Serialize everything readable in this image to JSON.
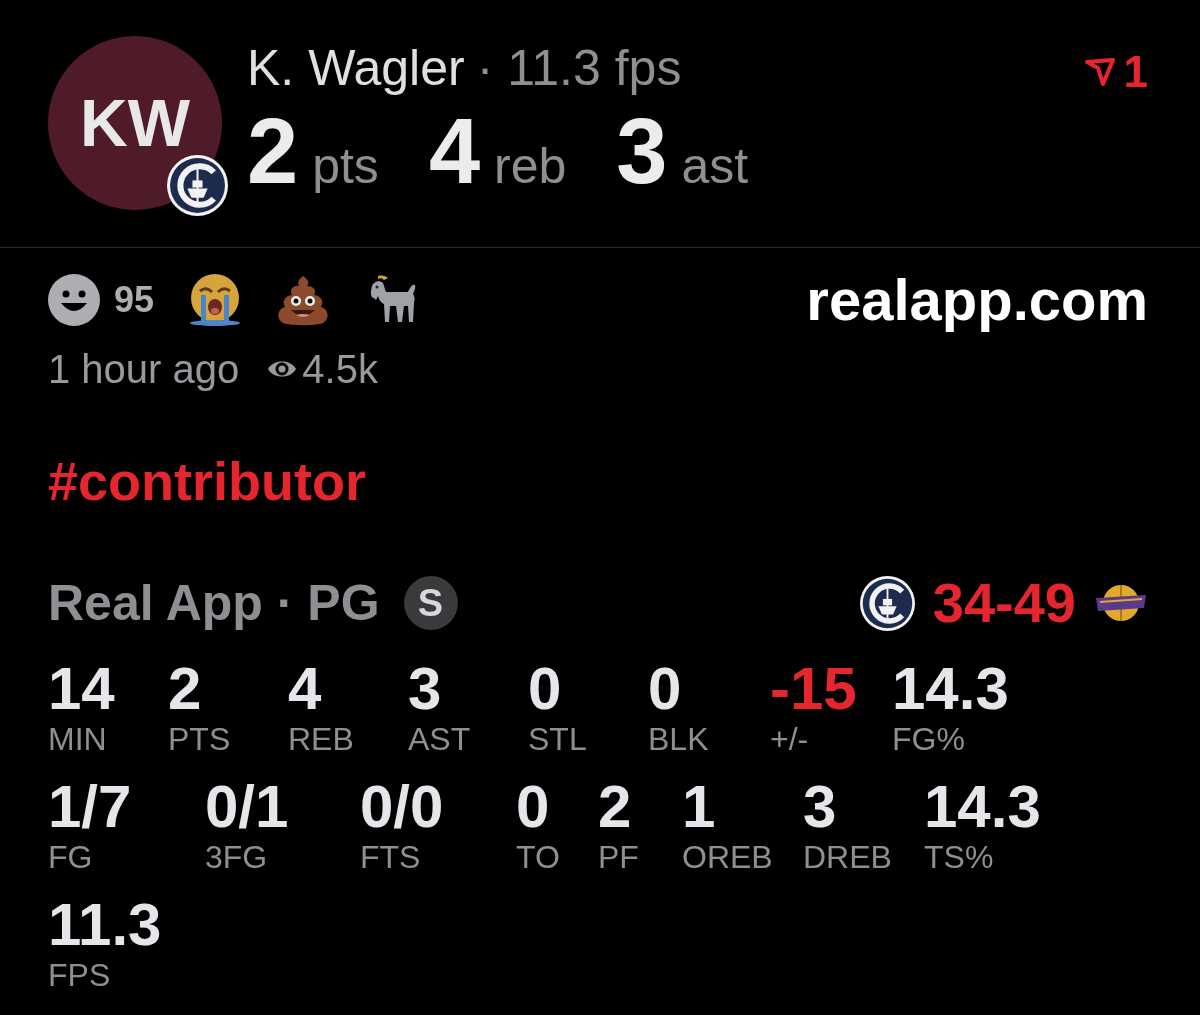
{
  "header": {
    "initials": "KW",
    "name": "K. Wagler",
    "subtitle": "· 11.3 fps",
    "stats": [
      {
        "value": "2",
        "unit": "pts"
      },
      {
        "value": "4",
        "unit": "reb"
      },
      {
        "value": "3",
        "unit": "ast"
      }
    ],
    "flag_count": "1"
  },
  "reactions": [
    {
      "kind": "smile",
      "count": "95"
    },
    {
      "kind": "crying"
    },
    {
      "kind": "poop"
    },
    {
      "kind": "goat"
    }
  ],
  "site": "realapp.com",
  "meta": {
    "time": "1 hour ago",
    "views": "4.5k"
  },
  "tag": "#contributor",
  "game": {
    "team_position": "Real App · PG",
    "starter_badge": "S",
    "score": "34-49",
    "won": false
  },
  "box_score": [
    [
      {
        "value": "14",
        "label": "MIN",
        "color": "#e5e5ea"
      },
      {
        "value": "2",
        "label": "PTS",
        "color": "#e5e5ea"
      },
      {
        "value": "4",
        "label": "REB",
        "color": "#e5e5ea"
      },
      {
        "value": "3",
        "label": "AST",
        "color": "#e5e5ea"
      },
      {
        "value": "0",
        "label": "STL",
        "color": "#e5e5ea"
      },
      {
        "value": "0",
        "label": "BLK",
        "color": "#e5e5ea"
      },
      {
        "value": "-15",
        "label": "+/-",
        "color": "#e5262f"
      },
      {
        "value": "14.3",
        "label": "FG%",
        "color": "#e5e5ea"
      }
    ],
    [
      {
        "value": "1/7",
        "label": "FG",
        "color": "#e5e5ea"
      },
      {
        "value": "0/1",
        "label": "3FG",
        "color": "#e5e5ea"
      },
      {
        "value": "0/0",
        "label": "FTS",
        "color": "#e5e5ea"
      },
      {
        "value": "0",
        "label": "TO",
        "color": "#e5e5ea"
      },
      {
        "value": "2",
        "label": "PF",
        "color": "#e5e5ea"
      },
      {
        "value": "1",
        "label": "OREB",
        "color": "#e5e5ea"
      },
      {
        "value": "3",
        "label": "DREB",
        "color": "#e5e5ea"
      },
      {
        "value": "14.3",
        "label": "TS%",
        "color": "#e5e5ea"
      }
    ],
    [
      {
        "value": "11.3",
        "label": "FPS",
        "color": "#e5e5ea"
      }
    ]
  ]
}
